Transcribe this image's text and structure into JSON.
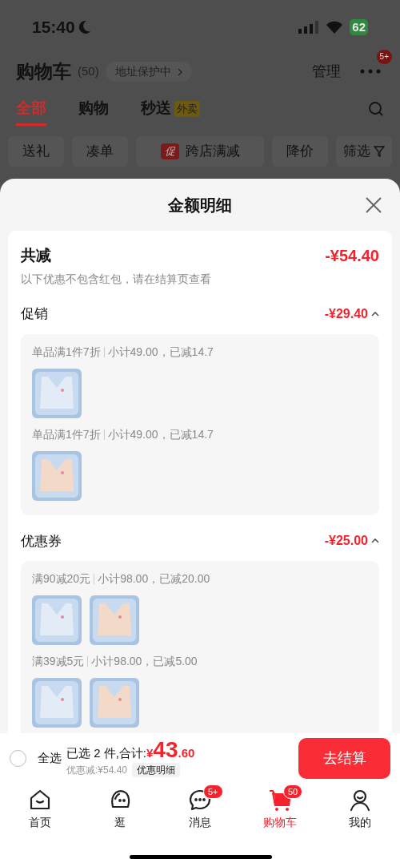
{
  "status_bar": {
    "time": "15:40",
    "battery": "62"
  },
  "header": {
    "title": "购物车",
    "count": "(50)",
    "address": "地址保护中",
    "manage": "管理",
    "more_badge": "5+"
  },
  "tabs": [
    {
      "label": "全部",
      "selected": true
    },
    {
      "label": "购物",
      "selected": false
    },
    {
      "label": "秒送",
      "selected": false,
      "tag": "外卖"
    }
  ],
  "chips": [
    {
      "kind": "plain",
      "label": "送礼"
    },
    {
      "kind": "plain",
      "label": "凑单"
    },
    {
      "kind": "promo",
      "label": "跨店满减",
      "badge": "促"
    },
    {
      "kind": "plain",
      "label": "降价"
    },
    {
      "kind": "filter",
      "label": "筛选"
    }
  ],
  "sheet": {
    "title": "金额明细",
    "total": {
      "label": "共减",
      "amount": "-¥54.40",
      "note": "以下优惠不包含红包，请在结算页查看"
    },
    "sections": [
      {
        "title": "促销",
        "amount": "-¥29.40",
        "expanded": true,
        "groups": [
          {
            "rule": "单品满1件7折",
            "detail": "小计49.00，已减14.7",
            "products": [
              {
                "color": "#e2ebf6"
              }
            ]
          },
          {
            "rule": "单品满1件7折",
            "detail": "小计49.00，已减14.7",
            "products": [
              {
                "color": "#f3d9c8"
              }
            ]
          }
        ]
      },
      {
        "title": "优惠券",
        "amount": "-¥25.00",
        "expanded": true,
        "groups": [
          {
            "rule": "满90减20元",
            "detail": "小计98.00，已减20.00",
            "products": [
              {
                "color": "#e2ebf6"
              },
              {
                "color": "#f3d9c8"
              }
            ]
          },
          {
            "rule": "满39减5元",
            "detail": "小计98.00，已减5.00",
            "products": [
              {
                "color": "#e2ebf6"
              },
              {
                "color": "#f3d9c8"
              }
            ]
          }
        ]
      }
    ]
  },
  "bottom_bar": {
    "select_all": {
      "label": "全选",
      "checked": false
    },
    "summary": "已选 2 件,合计:",
    "currency": "¥",
    "integer": "43",
    "decimals": ".60",
    "discount": "优惠减:¥54.40",
    "detail_button": "优惠明细",
    "checkout": "去结算"
  },
  "nav": [
    {
      "kind": "home",
      "label": "首页",
      "selected": false
    },
    {
      "kind": "browse",
      "label": "逛",
      "selected": false
    },
    {
      "kind": "message",
      "label": "消息",
      "selected": false,
      "badge": "5+"
    },
    {
      "kind": "cart",
      "label": "购物车",
      "selected": true,
      "badge": "50"
    },
    {
      "kind": "me",
      "label": "我的",
      "selected": false
    }
  ]
}
